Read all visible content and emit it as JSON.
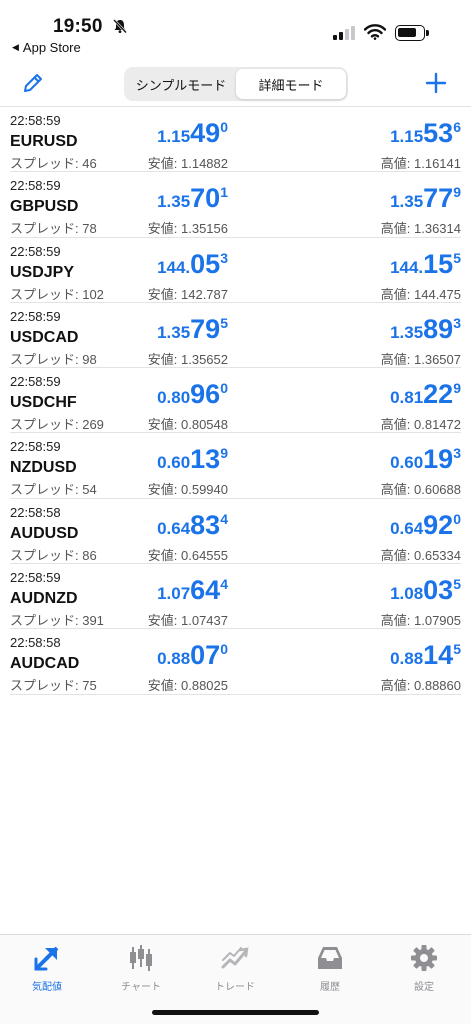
{
  "status_bar": {
    "time": "19:50",
    "back_app": "App Store"
  },
  "nav": {
    "tabs": [
      "シンプルモード",
      "詳細モード"
    ],
    "active_tab": 1
  },
  "quotes": [
    {
      "time": "22:58:59",
      "symbol": "EURUSD",
      "spread": "スプレッド: 46",
      "bid": {
        "pre": "1.15",
        "big": "49",
        "sup": "0"
      },
      "ask": {
        "pre": "1.15",
        "big": "53",
        "sup": "6"
      },
      "low": "安値: 1.14882",
      "high": "高値: 1.16141"
    },
    {
      "time": "22:58:59",
      "symbol": "GBPUSD",
      "spread": "スプレッド: 78",
      "bid": {
        "pre": "1.35",
        "big": "70",
        "sup": "1"
      },
      "ask": {
        "pre": "1.35",
        "big": "77",
        "sup": "9"
      },
      "low": "安値: 1.35156",
      "high": "高値: 1.36314"
    },
    {
      "time": "22:58:59",
      "symbol": "USDJPY",
      "spread": "スプレッド: 102",
      "bid": {
        "pre": "144.",
        "big": "05",
        "sup": "3"
      },
      "ask": {
        "pre": "144.",
        "big": "15",
        "sup": "5"
      },
      "low": "安値: 142.787",
      "high": "高値: 144.475"
    },
    {
      "time": "22:58:59",
      "symbol": "USDCAD",
      "spread": "スプレッド: 98",
      "bid": {
        "pre": "1.35",
        "big": "79",
        "sup": "5"
      },
      "ask": {
        "pre": "1.35",
        "big": "89",
        "sup": "3"
      },
      "low": "安値: 1.35652",
      "high": "高値: 1.36507"
    },
    {
      "time": "22:58:59",
      "symbol": "USDCHF",
      "spread": "スプレッド: 269",
      "bid": {
        "pre": "0.80",
        "big": "96",
        "sup": "0"
      },
      "ask": {
        "pre": "0.81",
        "big": "22",
        "sup": "9"
      },
      "low": "安値: 0.80548",
      "high": "高値: 0.81472"
    },
    {
      "time": "22:58:59",
      "symbol": "NZDUSD",
      "spread": "スプレッド: 54",
      "bid": {
        "pre": "0.60",
        "big": "13",
        "sup": "9"
      },
      "ask": {
        "pre": "0.60",
        "big": "19",
        "sup": "3"
      },
      "low": "安値: 0.59940",
      "high": "高値: 0.60688"
    },
    {
      "time": "22:58:58",
      "symbol": "AUDUSD",
      "spread": "スプレッド: 86",
      "bid": {
        "pre": "0.64",
        "big": "83",
        "sup": "4"
      },
      "ask": {
        "pre": "0.64",
        "big": "92",
        "sup": "0"
      },
      "low": "安値: 0.64555",
      "high": "高値: 0.65334"
    },
    {
      "time": "22:58:59",
      "symbol": "AUDNZD",
      "spread": "スプレッド: 391",
      "bid": {
        "pre": "1.07",
        "big": "64",
        "sup": "4"
      },
      "ask": {
        "pre": "1.08",
        "big": "03",
        "sup": "5"
      },
      "low": "安値: 1.07437",
      "high": "高値: 1.07905"
    },
    {
      "time": "22:58:58",
      "symbol": "AUDCAD",
      "spread": "スプレッド: 75",
      "bid": {
        "pre": "0.88",
        "big": "07",
        "sup": "0"
      },
      "ask": {
        "pre": "0.88",
        "big": "14",
        "sup": "5"
      },
      "low": "安値: 0.88025",
      "high": "高値: 0.88860"
    }
  ],
  "tabbar": {
    "items": [
      {
        "label": "気配値",
        "icon": "quotes-icon",
        "active": true
      },
      {
        "label": "チャート",
        "icon": "candlestick-icon",
        "active": false
      },
      {
        "label": "トレード",
        "icon": "trade-icon",
        "active": false
      },
      {
        "label": "履歴",
        "icon": "history-icon",
        "active": false
      },
      {
        "label": "設定",
        "icon": "gear-icon",
        "active": false
      }
    ]
  },
  "colors": {
    "accent": "#1a73e8",
    "inactive": "#8e8e93"
  }
}
